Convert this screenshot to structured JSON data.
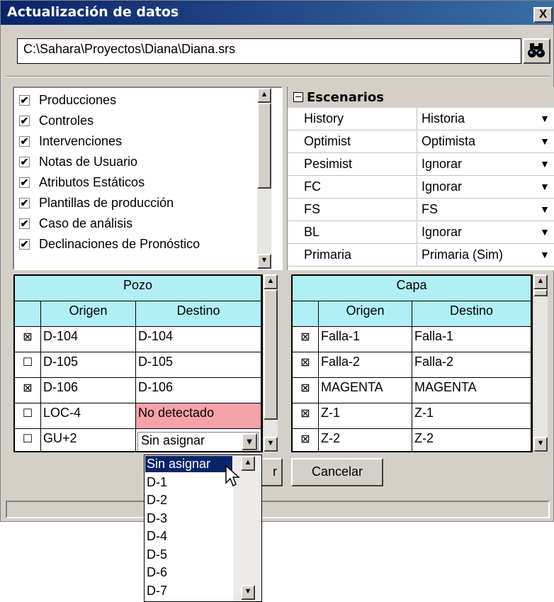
{
  "window": {
    "title": "Actualización de datos",
    "close": "X"
  },
  "path": {
    "value": "C:\\Sahara\\Proyectos\\Diana\\Diana.srs",
    "find_icon": "binoculars-icon"
  },
  "checklist": {
    "items": [
      {
        "label": "Producciones",
        "checked": true
      },
      {
        "label": "Controles",
        "checked": true
      },
      {
        "label": "Intervenciones",
        "checked": true
      },
      {
        "label": "Notas de Usuario",
        "checked": true
      },
      {
        "label": "Atributos Estáticos",
        "checked": true
      },
      {
        "label": "Plantillas de producción",
        "checked": true
      },
      {
        "label": "Caso de análisis",
        "checked": true
      },
      {
        "label": "Declinaciones de Pronóstico",
        "checked": true
      }
    ],
    "check_mark": "✔"
  },
  "escenarios": {
    "title": "Escenarios",
    "rows": [
      {
        "key": "History",
        "value": "Historia"
      },
      {
        "key": "Optimist",
        "value": "Optimista"
      },
      {
        "key": "Pesimist",
        "value": "Ignorar"
      },
      {
        "key": "FC",
        "value": "Ignorar"
      },
      {
        "key": "FS",
        "value": "FS"
      },
      {
        "key": "BL",
        "value": "Ignorar"
      },
      {
        "key": "Primaria",
        "value": "Primaria (Sim)"
      }
    ],
    "dd_arrow": "▼"
  },
  "pozo": {
    "title": "Pozo",
    "col_origen": "Origen",
    "col_destino": "Destino",
    "rows": [
      {
        "mark": "⊠",
        "origen": "D-104",
        "destino": "D-104"
      },
      {
        "mark": "☐",
        "origen": "D-105",
        "destino": "D-105"
      },
      {
        "mark": "⊠",
        "origen": "D-106",
        "destino": "D-106"
      },
      {
        "mark": "☐",
        "origen": "LOC-4",
        "destino": "No detectado"
      },
      {
        "mark": "☐",
        "origen": "GU+2",
        "destino": "Sin asignar"
      }
    ]
  },
  "capa": {
    "title": "Capa",
    "col_origen": "Origen",
    "col_destino": "Destino",
    "rows": [
      {
        "mark": "⊠",
        "origen": "Falla-1",
        "destino": "Falla-1"
      },
      {
        "mark": "⊠",
        "origen": "Falla-2",
        "destino": "Falla-2"
      },
      {
        "mark": "⊠",
        "origen": "MAGENTA",
        "destino": "MAGENTA"
      },
      {
        "mark": "⊠",
        "origen": "Z-1",
        "destino": "Z-1"
      },
      {
        "mark": "⊠",
        "origen": "Z-2",
        "destino": "Z-2"
      }
    ]
  },
  "buttons": {
    "accept_partial": "r",
    "cancel": "Cancelar"
  },
  "dropdown": {
    "items": [
      "Sin asignar",
      "D-1",
      "D-2",
      "D-3",
      "D-4",
      "D-5",
      "D-6",
      "D-7"
    ],
    "selected_index": 0
  },
  "colors": {
    "header_bg": "#b0eff5",
    "warning_bg": "#f5a3a8",
    "selection_bg": "#0a246a",
    "title_bg": "#0a246a"
  },
  "arrows": {
    "up": "▲",
    "down": "▼"
  }
}
